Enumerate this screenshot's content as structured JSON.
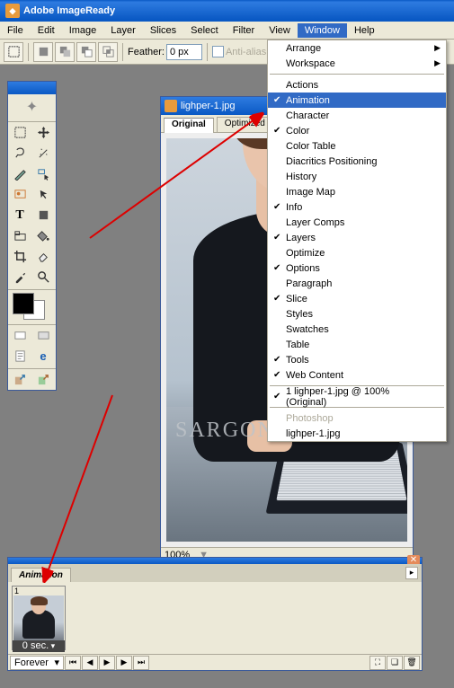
{
  "titlebar": {
    "app": "Adobe ImageReady"
  },
  "menubar": [
    "File",
    "Edit",
    "Image",
    "Layer",
    "Slices",
    "Select",
    "Filter",
    "View",
    "Window",
    "Help"
  ],
  "optbar": {
    "feather_label": "Feather:",
    "feather_value": "0 px",
    "aa_label": "Anti-alias"
  },
  "window_menu": {
    "top": [
      {
        "label": "Arrange",
        "sub": true
      },
      {
        "label": "Workspace",
        "sub": true
      }
    ],
    "mid": [
      {
        "label": "Actions"
      },
      {
        "label": "Animation",
        "hl": true,
        "check": true
      },
      {
        "label": "Character"
      },
      {
        "label": "Color",
        "check": true
      },
      {
        "label": "Color Table"
      },
      {
        "label": "Diacritics Positioning"
      },
      {
        "label": "History"
      },
      {
        "label": "Image Map"
      },
      {
        "label": "Info",
        "check": true
      },
      {
        "label": "Layer Comps"
      },
      {
        "label": "Layers",
        "check": true
      },
      {
        "label": "Optimize"
      },
      {
        "label": "Options",
        "check": true
      },
      {
        "label": "Paragraph"
      },
      {
        "label": "Slice",
        "check": true
      },
      {
        "label": "Styles"
      },
      {
        "label": "Swatches"
      },
      {
        "label": "Table"
      },
      {
        "label": "Tools",
        "check": true
      },
      {
        "label": "Web Content",
        "check": true
      }
    ],
    "docs": [
      {
        "label": "1 lighper-1.jpg @ 100% (Original)",
        "check": true
      }
    ],
    "bottom": [
      {
        "label": "Photoshop",
        "disabled": true
      },
      {
        "label": "lighper-1.jpg"
      }
    ]
  },
  "doc": {
    "title": "lighper-1.jpg",
    "tabs": [
      "Original",
      "Optimized"
    ],
    "watermark": "SARGONCO.COM",
    "status_zoom": "100%"
  },
  "anim": {
    "tab": "Animation",
    "frame_num": "1",
    "frame_time": "0 sec.",
    "loop": "Forever"
  }
}
